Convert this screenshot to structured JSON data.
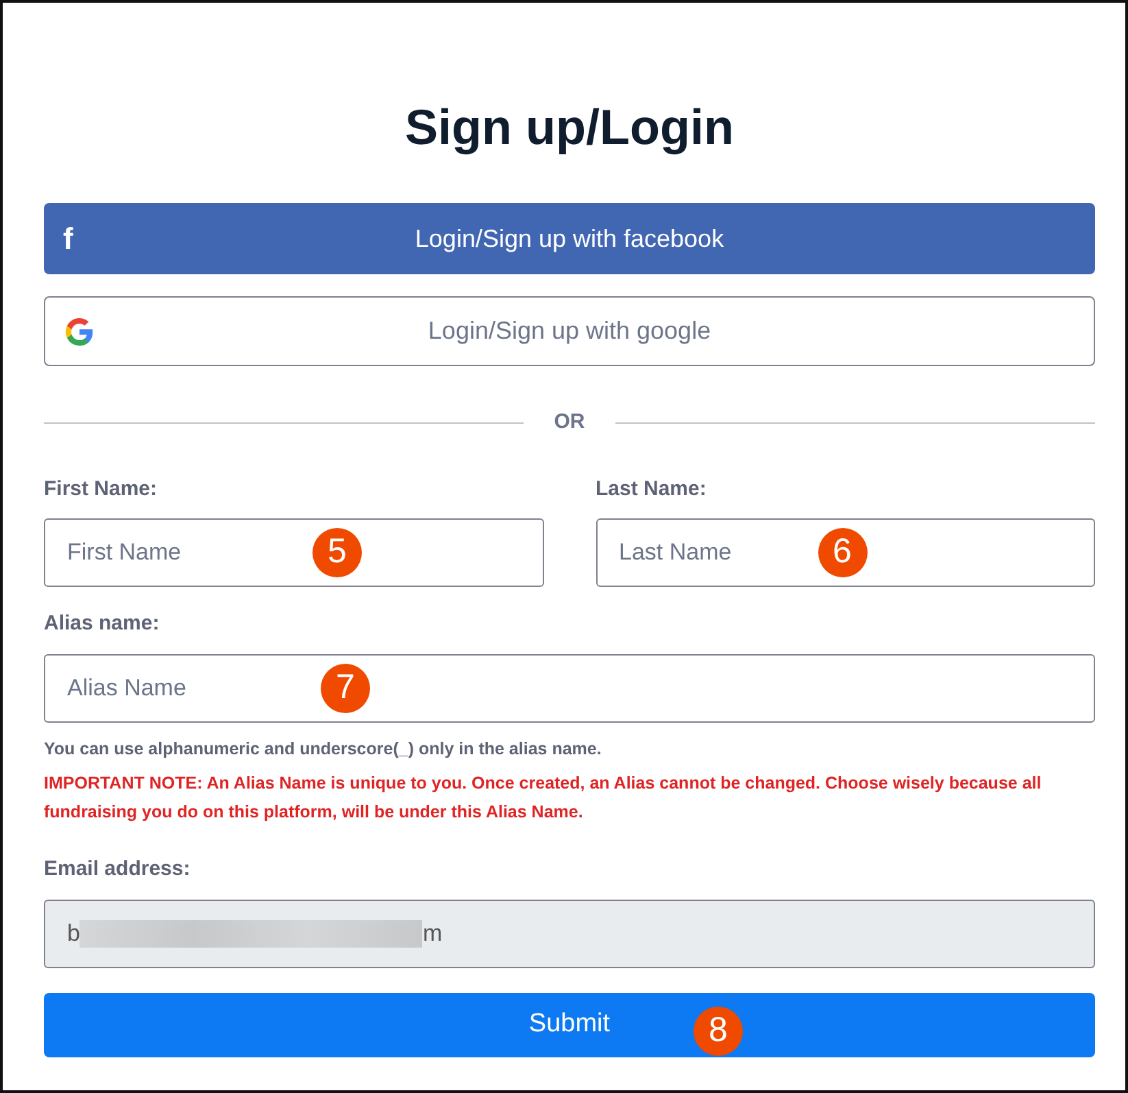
{
  "title": "Sign up/Login",
  "social_buttons": [
    {
      "kind": "facebook",
      "label": "Login/Sign up with facebook",
      "icon": "f"
    },
    {
      "kind": "google",
      "label": "Login/Sign up with google"
    }
  ],
  "divider": "OR",
  "name_fields": [
    {
      "label": "First Name:",
      "placeholder": "First Name",
      "marker": "5"
    },
    {
      "label": "Last Name:",
      "placeholder": "Last Name",
      "marker": "6"
    }
  ],
  "alias_field": {
    "label": "Alias name:",
    "placeholder": "Alias Name",
    "marker": "7"
  },
  "alias_help": "You can use alphanumeric and underscore(_) only in the alias name.",
  "important_note": "**IMPORTANT NOTE:** An Alias Name is unique to you. Once created, an Alias cannot be changed. Choose wisely because all fundraising you do on this platform, will be under this Alias Name.",
  "email_field": {
    "label": "Email address:",
    "value_start": "b",
    "value_end": "m",
    "redacted": true,
    "disabled": true
  },
  "submit": {
    "label": "Submit",
    "marker": "8"
  }
}
